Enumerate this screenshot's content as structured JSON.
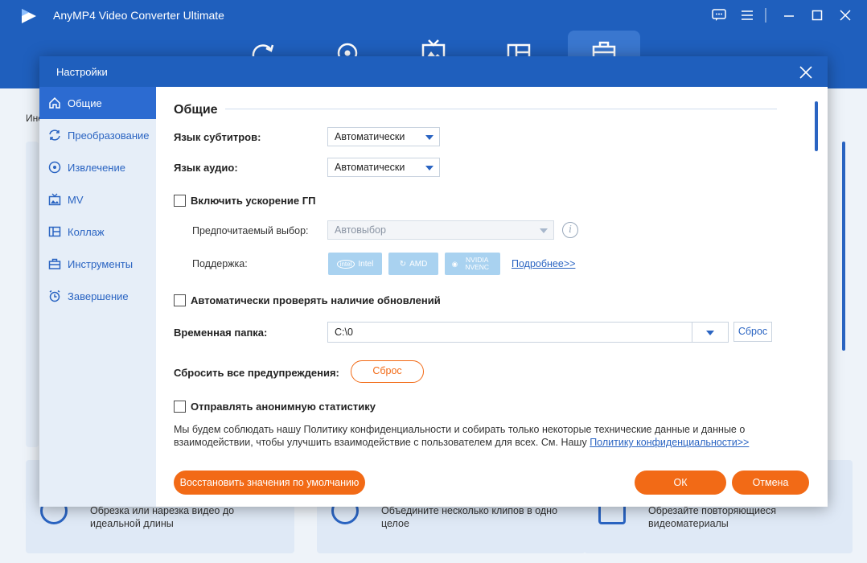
{
  "app": {
    "title": "AnyMP4 Video Converter Ultimate",
    "tools_label": "Инс",
    "bottom_cards": [
      {
        "text": "Обрезка или нарезка видео до идеальной длины"
      },
      {
        "text": "Объедините несколько клипов в одно целое"
      },
      {
        "text": "Обрезайте повторяющиеся видеоматериалы"
      }
    ]
  },
  "dialog": {
    "title": "Настройки",
    "sidebar": [
      {
        "label": "Общие",
        "icon": "home-icon"
      },
      {
        "label": "Преобразование",
        "icon": "convert-icon"
      },
      {
        "label": "Извлечение",
        "icon": "disc-icon"
      },
      {
        "label": "MV",
        "icon": "mv-icon"
      },
      {
        "label": "Коллаж",
        "icon": "collage-icon"
      },
      {
        "label": "Инструменты",
        "icon": "toolbox-icon"
      },
      {
        "label": "Завершение",
        "icon": "alarm-icon"
      }
    ],
    "general": {
      "heading": "Общие",
      "subtitle_lang_label": "Язык субтитров:",
      "subtitle_lang_value": "Автоматически",
      "audio_lang_label": "Язык аудио:",
      "audio_lang_value": "Автоматически",
      "gpu_label": "Включить ускорение ГП",
      "preferred_label": "Предпочитаемый выбор:",
      "preferred_value": "Автовыбор",
      "support_label": "Поддержка:",
      "gpu_badges": [
        "Intel",
        "AMD",
        "NVIDIA NVENC"
      ],
      "more_link": "Подробнее>>",
      "auto_update_label": "Автоматически проверять наличие обновлений",
      "temp_folder_label": "Временная папка:",
      "temp_folder_value": "C:\\0",
      "temp_reset": "Сброс",
      "reset_warnings_label": "Сбросить все предупреждения:",
      "reset_warnings_btn": "Сброс",
      "anon_stats_label": "Отправлять анонимную статистику",
      "privacy_text": "Мы будем соблюдать нашу Политику конфиденциальности и собирать только некоторые технические данные и данные о взаимодействии, чтобы улучшить взаимодействие с пользователем для всех. См. Нашу ",
      "privacy_link": "Политику конфиденциальности>>"
    },
    "buttons": {
      "restore": "Восстановить значения по умолчанию",
      "ok": "ОК",
      "cancel": "Отмена"
    },
    "colors": {
      "accent": "#1f5fbd",
      "orange": "#f26a16"
    }
  }
}
